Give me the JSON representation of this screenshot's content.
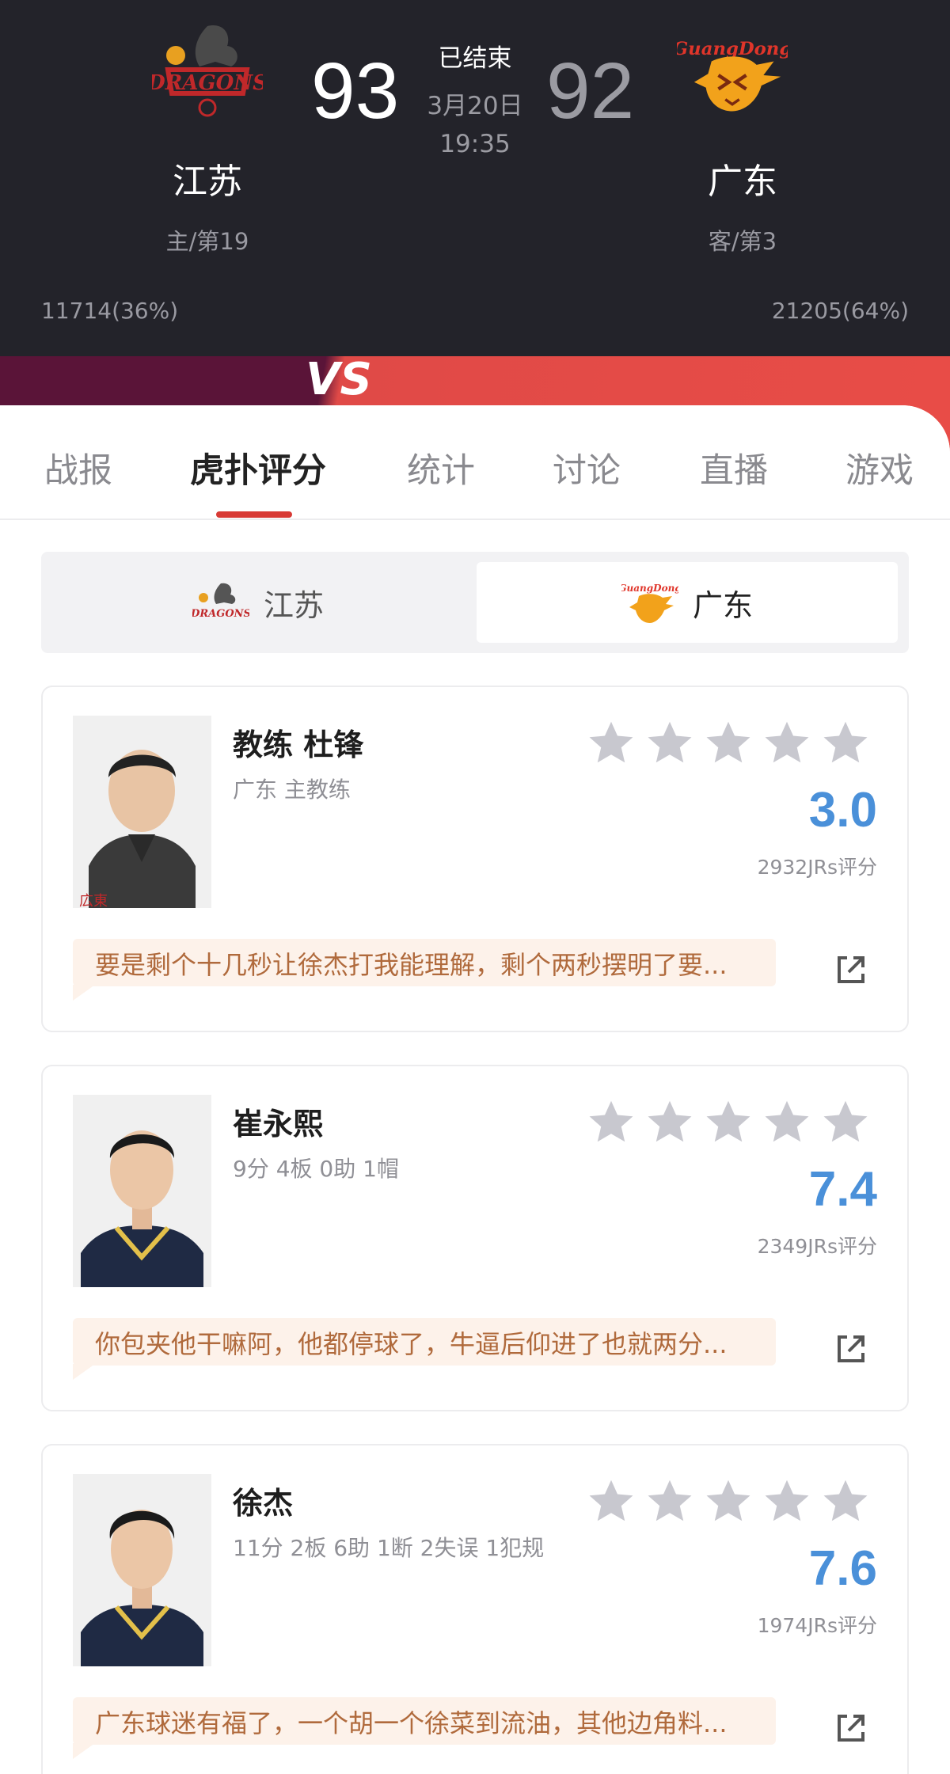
{
  "match": {
    "status": "已结束",
    "date": "3月20日",
    "time": "19:35",
    "home": {
      "name": "江苏",
      "rank": "主/第19",
      "score": "93",
      "support": "11714(36%)"
    },
    "away": {
      "name": "广东",
      "rank": "客/第3",
      "score": "92",
      "support": "21205(64%)"
    }
  },
  "tabs": [
    {
      "label": "战报"
    },
    {
      "label": "虎扑评分"
    },
    {
      "label": "统计"
    },
    {
      "label": "讨论"
    },
    {
      "label": "直播"
    },
    {
      "label": "游戏"
    }
  ],
  "switcher": {
    "home_label": "江苏",
    "away_label": "广东",
    "selected": "广东"
  },
  "players": [
    {
      "name": "教练 杜锋",
      "info": "广东 主教练",
      "rating": "3.0",
      "votes": "2932JRs评分",
      "comment": "要是剩个十几秒让徐杰打我能理解，剩个两秒摆明了要..."
    },
    {
      "name": "崔永熙",
      "info": "9分 4板 0助 1帽",
      "rating": "7.4",
      "votes": "2349JRs评分",
      "comment": "你包夹他干嘛阿，他都停球了，牛逼后仰进了也就两分..."
    },
    {
      "name": "徐杰",
      "info": "11分 2板 6助 1断 2失误 1犯规",
      "rating": "7.6",
      "votes": "1974JRs评分",
      "comment": "广东球迷有福了，一个胡一个徐菜到流油，其他边角料..."
    }
  ],
  "colors": {
    "header_bg": "#23232a",
    "accent_red": "#d83a35",
    "rating_blue": "#4a90d9",
    "comment_text": "#b06a3c",
    "comment_bg": "#fdf2ea"
  }
}
